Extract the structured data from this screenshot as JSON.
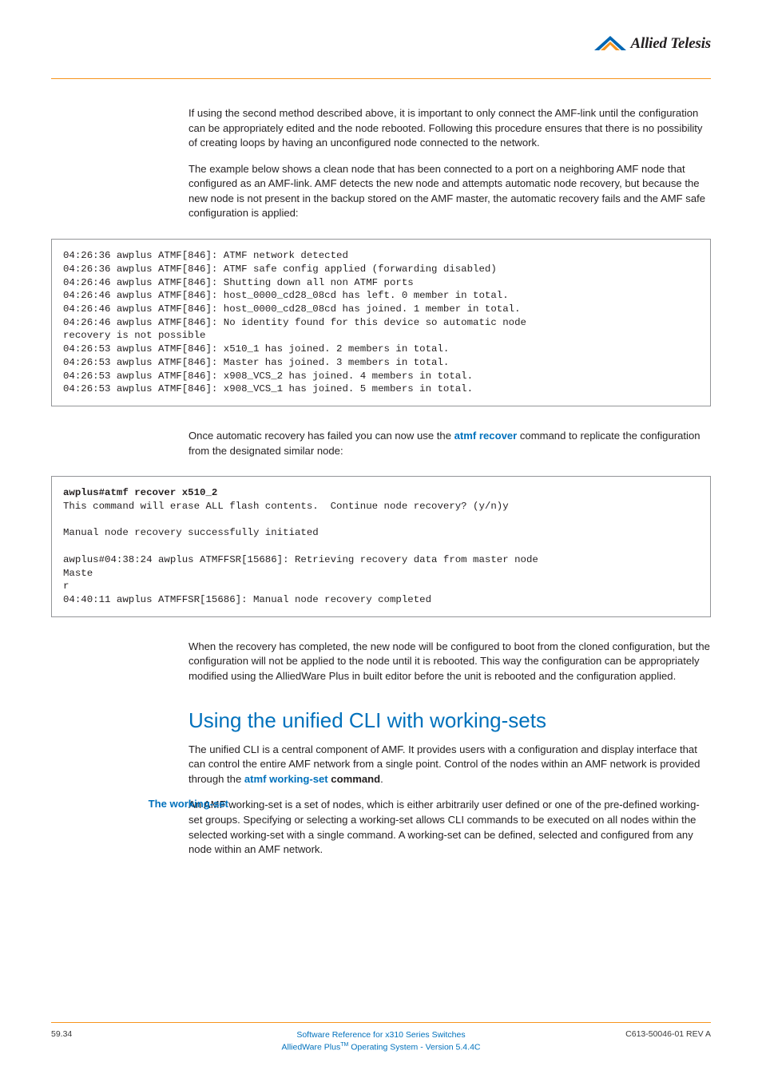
{
  "brand": {
    "name": "Allied Telesis"
  },
  "paragraphs": {
    "p1": "If using the second method described above, it is important to only connect the AMF-link until the configuration can be appropriately edited and the node rebooted. Following this procedure ensures that there is no possibility of creating loops by having an unconfigured node connected to the network.",
    "p2": "The example below shows a clean node that has been connected to a port on a neighboring AMF node that configured as an AMF-link. AMF detects the new node and attempts automatic node recovery, but because the new node is not present in the backup stored on the AMF master, the automatic recovery fails and the AMF safe configuration is applied:",
    "p3a": "Once automatic recovery has failed you can now use the ",
    "p3link": "atmf recover",
    "p3b": " command to replicate the configuration from the designated similar node:",
    "p4": "When the recovery has completed, the new node will be configured to boot from the cloned configuration, but the configuration will not be applied to the node until it is rebooted. This way the configuration can be appropriately modified using the AlliedWare Plus in built editor before the unit is rebooted and the configuration applied.",
    "p5a": "The unified CLI is a central component of AMF. It provides users with a configuration and display interface that can control the entire AMF network from a single point. Control of the nodes within an AMF network is provided through the ",
    "p5link": "atmf working-set",
    "p5b": " command",
    "p6": "An AMF working-set is a set of nodes, which is either arbitrarily user defined or one of the pre-defined working-set groups. Specifying or selecting a working-set allows CLI commands to be executed on all nodes within the selected working-set with a single command. A working-set can be defined, selected and configured from any node within an AMF network."
  },
  "codebox1": "04:26:36 awplus ATMF[846]: ATMF network detected\n04:26:36 awplus ATMF[846]: ATMF safe config applied (forwarding disabled)\n04:26:46 awplus ATMF[846]: Shutting down all non ATMF ports\n04:26:46 awplus ATMF[846]: host_0000_cd28_08cd has left. 0 member in total.\n04:26:46 awplus ATMF[846]: host_0000_cd28_08cd has joined. 1 member in total.\n04:26:46 awplus ATMF[846]: No identity found for this device so automatic node \nrecovery is not possible\n04:26:53 awplus ATMF[846]: x510_1 has joined. 2 members in total.\n04:26:53 awplus ATMF[846]: Master has joined. 3 members in total.\n04:26:53 awplus ATMF[846]: x908_VCS_2 has joined. 4 members in total.\n04:26:53 awplus ATMF[846]: x908_VCS_1 has joined. 5 members in total.\n",
  "codebox2_cmd": "awplus#atmf recover x510_2",
  "codebox2_body": "This command will erase ALL flash contents.  Continue node recovery? (y/n)y\n\nManual node recovery successfully initiated\n\nawplus#04:38:24 awplus ATMFFSR[15686]: Retrieving recovery data from master node \nMaste\nr\n04:40:11 awplus ATMFFSR[15686]: Manual node recovery completed\n",
  "heading": "Using the unified CLI with working-sets",
  "sidelabel": "The working-set",
  "footer": {
    "left": "59.34",
    "center1": "Software Reference for x310 Series Switches",
    "center2a": "AlliedWare Plus",
    "center2sup": "TM",
    "center2b": " Operating System  - Version 5.4.4C",
    "right": "C613-50046-01 REV A"
  }
}
